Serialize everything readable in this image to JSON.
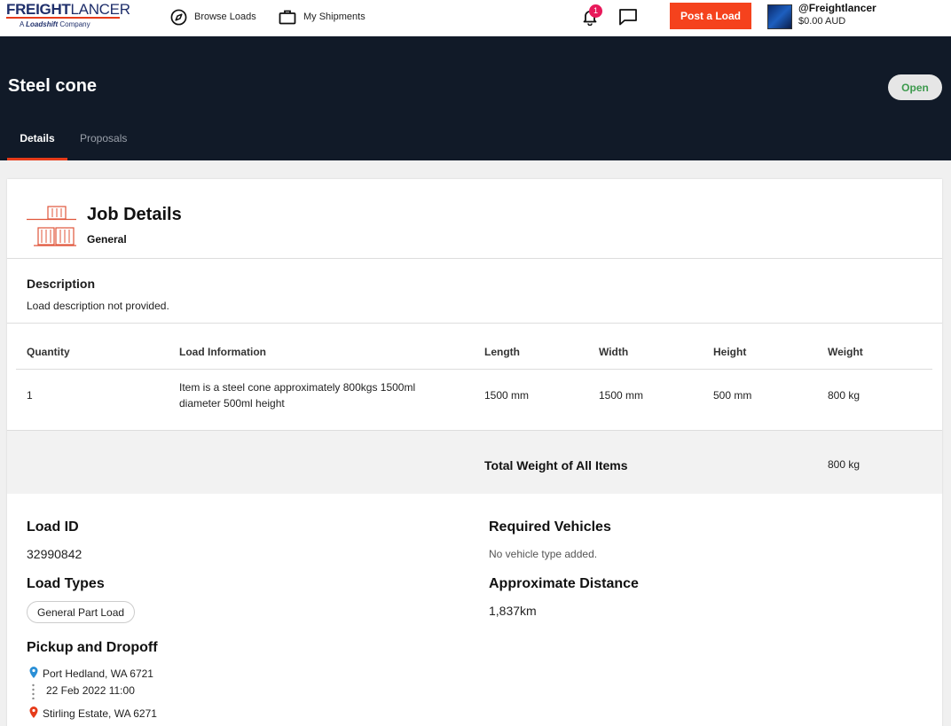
{
  "brand": {
    "name_bold": "FREIGHT",
    "name_light": "LANCER",
    "tagline_prefix": "A",
    "tagline_brand": "Loadshift",
    "tagline_suffix": "Company"
  },
  "nav": {
    "browse_loads": "Browse Loads",
    "my_shipments": "My Shipments",
    "notification_count": "1",
    "post_load": "Post a Load"
  },
  "user": {
    "handle": "@Freightlancer",
    "balance": "$0.00 AUD"
  },
  "header": {
    "title": "Steel cone",
    "status": "Open",
    "tabs": [
      "Details",
      "Proposals"
    ]
  },
  "job": {
    "title": "Job Details",
    "category": "General",
    "description_label": "Description",
    "description": "Load description not provided."
  },
  "table": {
    "headers": [
      "Quantity",
      "Load Information",
      "Length",
      "Width",
      "Height",
      "Weight"
    ],
    "rows": [
      {
        "quantity": "1",
        "info_line1": "Item is a steel cone approximately 800kgs 1500ml",
        "info_line2": "diameter 500ml height",
        "length": "1500 mm",
        "width": "1500 mm",
        "height": "500 mm",
        "weight": "800 kg"
      }
    ],
    "total_label": "Total Weight of All Items",
    "total_value": "800 kg"
  },
  "details": {
    "load_id_label": "Load ID",
    "load_id": "32990842",
    "load_types_label": "Load Types",
    "load_types": [
      "General Part Load"
    ],
    "required_vehicles_label": "Required Vehicles",
    "required_vehicles": "No vehicle type added.",
    "distance_label": "Approximate Distance",
    "distance": "1,837km",
    "route_label": "Pickup and Dropoff",
    "pickup": "Port Hedland, WA 6721",
    "pickup_date": "22 Feb 2022 11:00",
    "dropoff": "Stirling Estate, WA 6271"
  },
  "colors": {
    "accent": "#f5421d",
    "header_bg": "#111a28",
    "status_text": "#3d9a4d",
    "pickup_pin": "#2a8fd6",
    "dropoff_pin": "#e63b1a",
    "notification_badge": "#e8185a"
  }
}
